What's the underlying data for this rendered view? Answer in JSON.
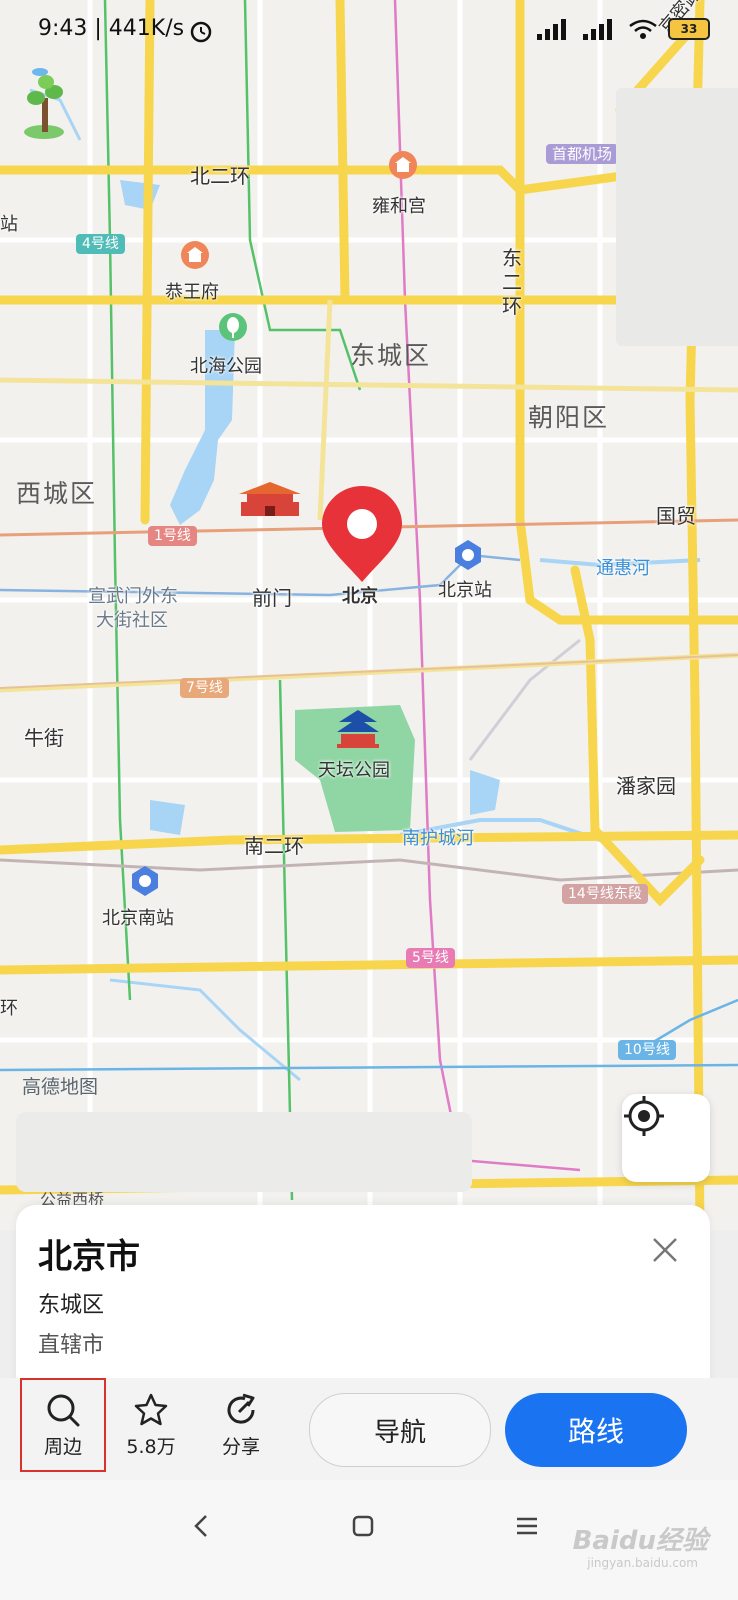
{
  "status_bar": {
    "time": "9:43 | 441K/s",
    "battery": "33"
  },
  "map": {
    "districts": [
      "东城区",
      "朝阳区",
      "西城区"
    ],
    "roads": [
      "北二环",
      "东二环",
      "南二环",
      "京密路"
    ],
    "pois": [
      "雍和宫",
      "恭王府",
      "北海公园",
      "前门",
      "北京",
      "北京站",
      "宣武门外东",
      "大街社区",
      "天坛公园",
      "北京南站",
      "潘家园",
      "牛街",
      "国贸",
      "首都机场",
      "站",
      "环"
    ],
    "water": [
      "通惠河",
      "南护城河"
    ],
    "metro_lines": [
      "4号线",
      "1号线",
      "7号线",
      "14号线东段",
      "5号线",
      "10号线"
    ],
    "map_brand": "高德地图",
    "partial_bottom": "公益西桥"
  },
  "place": {
    "title": "北京市",
    "district": "东城区",
    "type": "直辖市"
  },
  "actions": {
    "nearby": "周边",
    "favorite_count": "5.8万",
    "share": "分享",
    "navigate": "导航",
    "route": "路线"
  },
  "watermark": {
    "main": "Baidu经验",
    "sub": "jingyan.baidu.com"
  },
  "colors": {
    "route_blue": "#1a73f0",
    "highlight_red": "#d9312c",
    "major_road": "#f7d64d",
    "park_green": "#8fd6a4",
    "water_blue": "#a8d4f5"
  }
}
